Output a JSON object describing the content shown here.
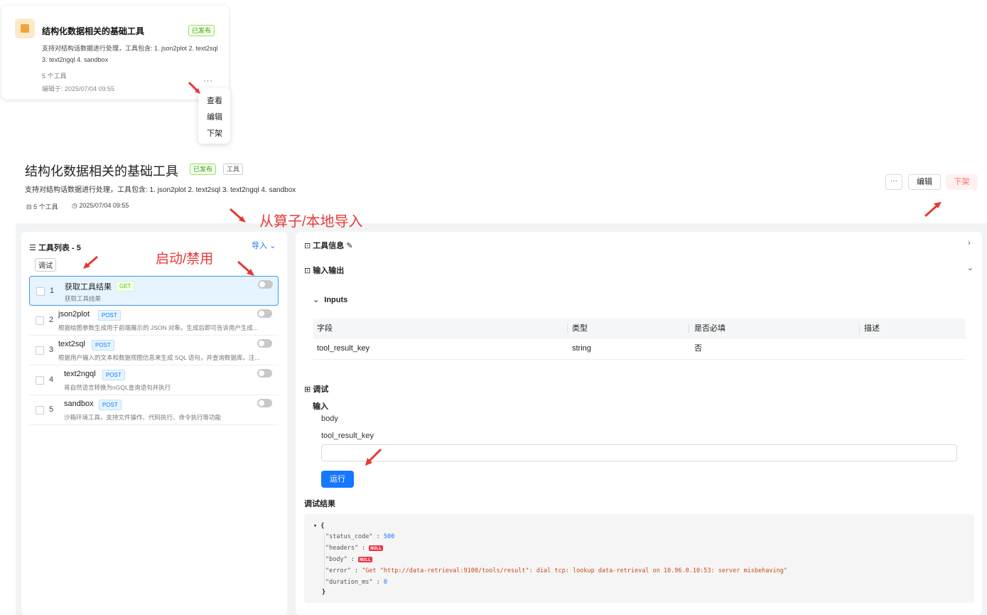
{
  "card": {
    "title": "结构化数据相关的基础工具",
    "status": "已发布",
    "desc": "支持对结构话数据进行处理，工具包含: 1. json2plot 2. text2sql 3. text2ngql 4. sandbox",
    "count": "5 个工具",
    "edited": "编辑于: 2025/07/04 09:55",
    "more": "···"
  },
  "context_menu": [
    "查看",
    "编辑",
    "下架"
  ],
  "header": {
    "title": "结构化数据相关的基础工具",
    "status": "已发布",
    "type_tag": "工具",
    "desc": "支持对结构话数据进行处理，工具包含: 1. json2plot 2. text2sql 3. text2ngql 4. sandbox",
    "count": "5 个工具",
    "time": "2025/07/04 09:55",
    "more_label": "···",
    "edit_label": "编辑",
    "unpublish_label": "下架"
  },
  "annotations": {
    "import_note": "从算子/本地导入",
    "toggle_note": "启动/禁用"
  },
  "tool_list": {
    "title": "工具列表 - 5",
    "import_label": "导入",
    "debug_label": "调试",
    "items": [
      {
        "num": "1",
        "name": "获取工具结果",
        "method": "GET",
        "desc": "获取工具结果"
      },
      {
        "num": "2",
        "name": "json2plot",
        "method": "POST",
        "desc": "根据绘图参数生成用于前端展示的 JSON 对象。生成后即可告诉用户生成..."
      },
      {
        "num": "3",
        "name": "text2sql",
        "method": "POST",
        "desc": "根据用户输入的文本和数据视图信息来生成 SQL 语句，并查询数据库。注..."
      },
      {
        "num": "4",
        "name": "text2ngql",
        "method": "POST",
        "desc": "将自然语言转换为nGQL查询语句并执行"
      },
      {
        "num": "5",
        "name": "sandbox",
        "method": "POST",
        "desc": "沙箱环境工具，支持文件操作、代码执行、命令执行等功能"
      }
    ]
  },
  "detail": {
    "tool_info": "工具信息",
    "io_title": "输入输出",
    "inputs_title": "Inputs",
    "columns": [
      "字段",
      "类型",
      "是否必填",
      "描述"
    ],
    "rows": [
      {
        "field": "tool_result_key",
        "type": "string",
        "required": "否",
        "desc": ""
      }
    ],
    "debug_title": "调试",
    "input_label": "输入",
    "body_label": "body",
    "param_label": "tool_result_key",
    "param_value": "",
    "run_label": "运行",
    "result_title": "调试结果",
    "result": {
      "status_code_key": "\"status_code\"",
      "status_code": "500",
      "headers_key": "\"headers\"",
      "body_key": "\"body\"",
      "null": "NULL",
      "error_key": "\"error\"",
      "error": "\"Get \"http://data-retrieval:9100/tools/result\": dial tcp: lookup data-retrieval on 10.96.0.10:53: server misbehaving\"",
      "duration_key": "\"duration_ms\"",
      "duration": "0"
    }
  }
}
